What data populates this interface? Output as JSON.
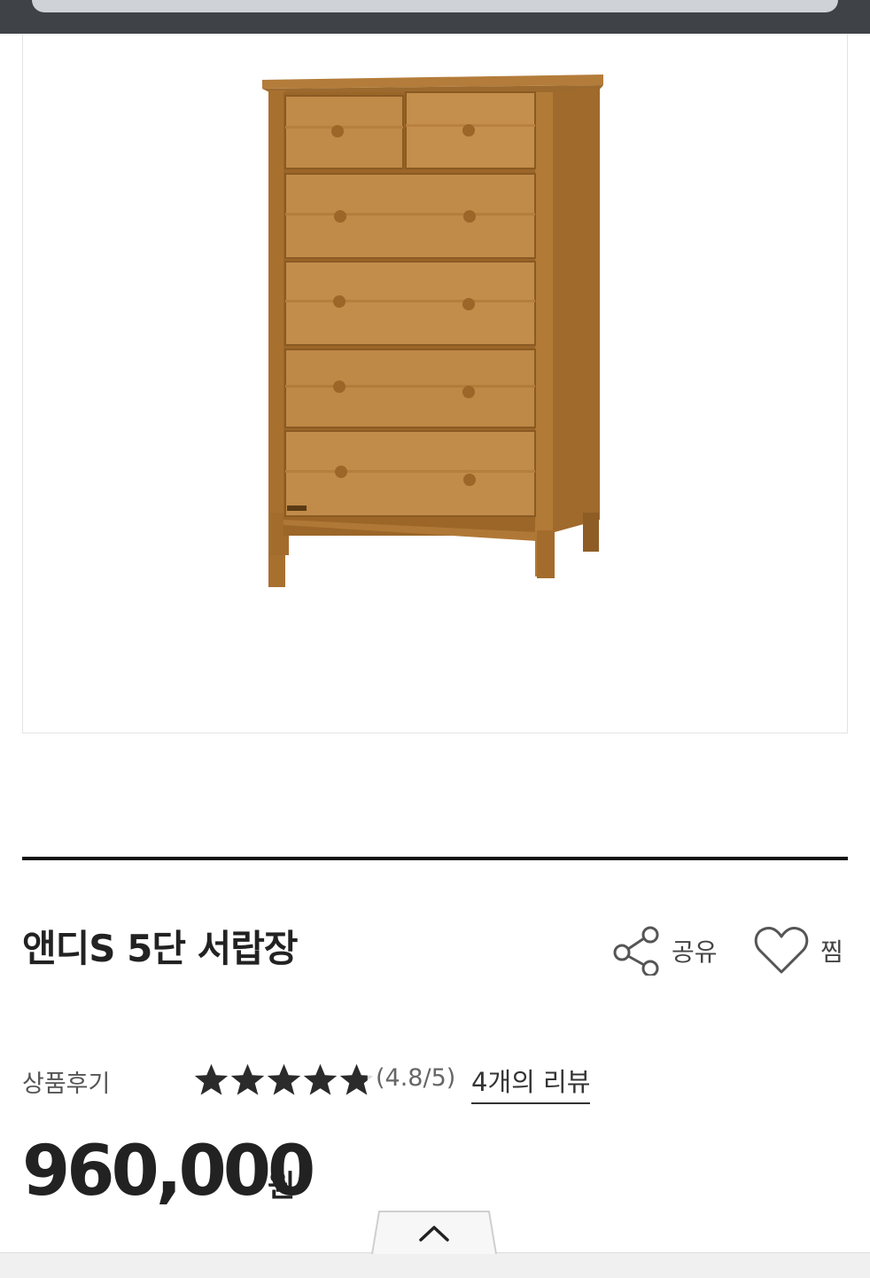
{
  "product": {
    "title": "앤디S 5단 서랍장",
    "image_icon": "dresser-product-image"
  },
  "actions": {
    "share_label": "공유",
    "share_icon": "share-icon",
    "wish_label": "찜",
    "wish_icon": "heart-icon"
  },
  "reviews": {
    "label": "상품후기",
    "rating_value": 4.8,
    "rating_max": 5,
    "rating_text": "(4.8/5)",
    "count_link": "4개의 리뷰"
  },
  "price": {
    "amount": "960,000",
    "currency": "원"
  },
  "bottom": {
    "collapse_icon": "chevron-up-icon"
  },
  "colors": {
    "top_bar": "#3f4247",
    "divider": "#111111",
    "star": "#2b2b2b",
    "text_dark": "#222222"
  }
}
